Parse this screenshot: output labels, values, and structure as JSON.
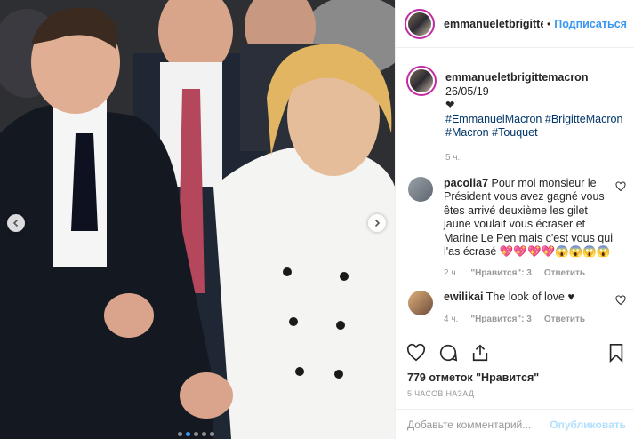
{
  "header": {
    "username": "emmanueletbrigitte",
    "separator": "•",
    "follow_label": "Подписаться"
  },
  "caption": {
    "username": "emmanueletbrigittemacron",
    "date": "26/05/19",
    "heart": "❤",
    "hashtags": [
      "#EmmanuelMacron",
      "#BrigitteMacron",
      "#Macron",
      "#Touquet"
    ],
    "time_ago": "5 ч."
  },
  "comments": [
    {
      "username": "pacolia7",
      "text": "Pour moi monsieur le Président vous avez gagné vous êtes arrivé deuxième les gilet jaune voulait vous écraser et Marine Le Pen mais c'est vous qui l'as écrasé 💖💖💖💖😱😱😱😱",
      "time": "2 ч.",
      "likes": "\"Нравится\": 3",
      "reply": "Ответить"
    },
    {
      "username": "ewilikai",
      "text": "The look of love ♥",
      "time": "4 ч.",
      "likes": "\"Нравится\": 3",
      "reply": "Ответить"
    }
  ],
  "likes_count": "779 отметок \"Нравится\"",
  "post_date": "5 ЧАСОВ НАЗАД",
  "add_comment": {
    "placeholder": "Добавьте комментарий...",
    "publish_label": "Опубликовать"
  },
  "carousel": {
    "dots": 5,
    "active_index": 1
  },
  "colors": {
    "accent": "#3897f0",
    "publish_disabled": "#b2dffc",
    "hashtag": "#003569"
  }
}
